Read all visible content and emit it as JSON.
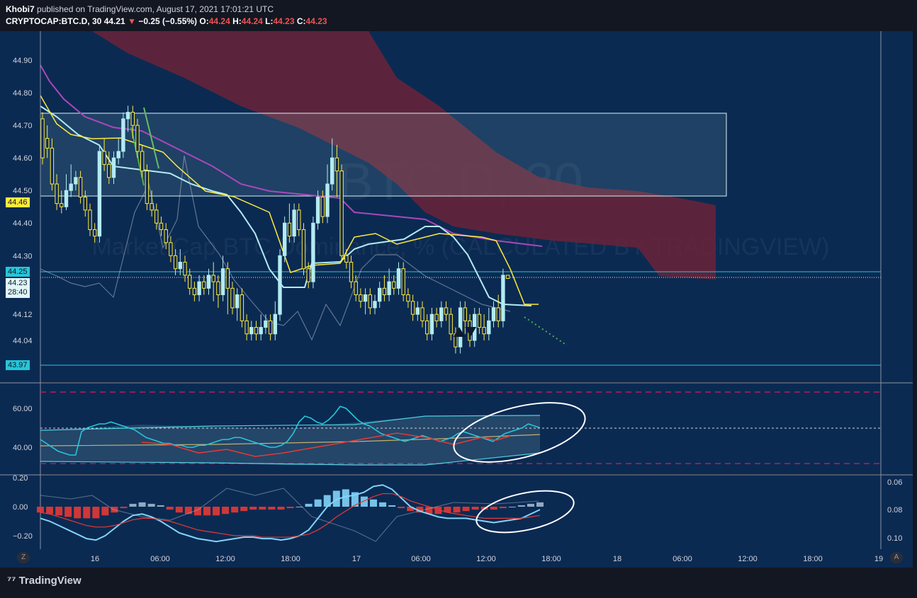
{
  "header": {
    "author": "Khobi7",
    "published_text": "published on TradingView.com, August 17, 2021 17:01:21 UTC",
    "symbol": "CRYPTOCAP:BTC.D, 30",
    "last": "44.21",
    "change_arrow": "▼",
    "change": "−0.25 (−0.55%)",
    "o_label": "O:",
    "o_value": "44.24",
    "h_label": "H:",
    "h_value": "44.24",
    "l_label": "L:",
    "l_value": "44.23",
    "c_label": "C:",
    "c_value": "44.23"
  },
  "watermark": {
    "big": "BTC.D, 30",
    "small": "Market Cap BTC Dominance, % (CALCULATED BY TRADINGVIEW)"
  },
  "price_labels": {
    "level_high": "44.46",
    "level_cyan": "44.25",
    "last_price": "44.23",
    "countdown": "28:40",
    "level_low": "43.97"
  },
  "brand": "TradingView",
  "corner_left": "Z",
  "corner_right": "A",
  "colors": {
    "background": "#0b2a52",
    "bull": "#b2ebf2",
    "bear": "#ffeb3b",
    "cloud": "#6b2338",
    "rsi_line": "#26c6da",
    "rsi_red": "#e53935",
    "macd_line": "#81d4fa"
  },
  "chart_data": [
    {
      "type": "candlestick",
      "title": "CRYPTOCAP:BTC.D, 30",
      "ylim": [
        43.9,
        44.97
      ],
      "yticks": [
        "44.90",
        "44.80",
        "44.70",
        "44.60",
        "44.50",
        "44.40",
        "44.30",
        "44.12",
        "44.04"
      ],
      "xticks": [
        "16",
        "06:00",
        "12:00",
        "18:00",
        "17",
        "06:00",
        "12:00",
        "18:00",
        "18",
        "06:00",
        "12:00",
        "18:00",
        "19"
      ],
      "candles": [
        [
          44.72,
          44.6,
          44.74,
          44.58
        ],
        [
          44.66,
          44.63,
          44.7,
          44.6
        ],
        [
          44.63,
          44.52,
          44.66,
          44.5
        ],
        [
          44.52,
          44.46,
          44.55,
          44.44
        ],
        [
          44.46,
          44.45,
          44.5,
          44.43
        ],
        [
          44.45,
          44.5,
          44.55,
          44.44
        ],
        [
          44.5,
          44.52,
          44.58,
          44.48
        ],
        [
          44.52,
          44.54,
          44.56,
          44.5
        ],
        [
          44.54,
          44.48,
          44.56,
          44.46
        ],
        [
          44.48,
          44.44,
          44.5,
          44.42
        ],
        [
          44.44,
          44.38,
          44.46,
          44.36
        ],
        [
          44.38,
          44.36,
          44.4,
          44.34
        ],
        [
          44.36,
          44.62,
          44.64,
          44.34
        ],
        [
          44.62,
          44.58,
          44.66,
          44.56
        ],
        [
          44.58,
          44.54,
          44.62,
          44.52
        ],
        [
          44.54,
          44.6,
          44.62,
          44.52
        ],
        [
          44.6,
          44.62,
          44.66,
          44.58
        ],
        [
          44.62,
          44.72,
          44.74,
          44.6
        ],
        [
          44.72,
          44.74,
          44.76,
          44.68
        ],
        [
          44.74,
          44.7,
          44.76,
          44.66
        ],
        [
          44.7,
          44.62,
          44.72,
          44.6
        ],
        [
          44.62,
          44.56,
          44.64,
          44.54
        ],
        [
          44.56,
          44.46,
          44.58,
          44.44
        ],
        [
          44.46,
          44.44,
          44.5,
          44.42
        ],
        [
          44.44,
          44.4,
          44.46,
          44.38
        ],
        [
          44.4,
          44.38,
          44.42,
          44.36
        ],
        [
          44.38,
          44.34,
          44.4,
          44.32
        ],
        [
          44.34,
          44.3,
          44.36,
          44.28
        ],
        [
          44.3,
          44.26,
          44.32,
          44.24
        ],
        [
          44.26,
          44.28,
          44.32,
          44.24
        ],
        [
          44.28,
          44.24,
          44.3,
          44.22
        ],
        [
          44.24,
          44.2,
          44.26,
          44.18
        ],
        [
          44.2,
          44.18,
          44.22,
          44.16
        ],
        [
          44.18,
          44.22,
          44.24,
          44.16
        ],
        [
          44.22,
          44.2,
          44.24,
          44.18
        ],
        [
          44.2,
          44.24,
          44.26,
          44.18
        ],
        [
          44.24,
          44.22,
          44.28,
          44.16
        ],
        [
          44.22,
          44.18,
          44.24,
          44.14
        ],
        [
          44.18,
          44.26,
          44.3,
          44.16
        ],
        [
          44.26,
          44.2,
          44.28,
          44.12
        ],
        [
          44.2,
          44.14,
          44.22,
          44.12
        ],
        [
          44.14,
          44.18,
          44.2,
          44.1
        ],
        [
          44.18,
          44.1,
          44.2,
          44.08
        ],
        [
          44.1,
          44.06,
          44.12,
          44.04
        ],
        [
          44.06,
          44.08,
          44.1,
          44.04
        ],
        [
          44.08,
          44.06,
          44.1,
          44.04
        ],
        [
          44.06,
          44.08,
          44.12,
          44.04
        ],
        [
          44.08,
          44.1,
          44.12,
          44.06
        ],
        [
          44.1,
          44.06,
          44.12,
          44.04
        ],
        [
          44.06,
          44.12,
          44.16,
          44.04
        ],
        [
          44.12,
          44.3,
          44.32,
          44.1
        ],
        [
          44.3,
          44.4,
          44.42,
          44.28
        ],
        [
          44.4,
          44.36,
          44.46,
          44.34
        ],
        [
          44.36,
          44.44,
          44.46,
          44.34
        ],
        [
          44.44,
          44.38,
          44.46,
          44.36
        ],
        [
          44.38,
          44.26,
          44.4,
          44.24
        ],
        [
          44.26,
          44.22,
          44.28,
          44.2
        ],
        [
          44.22,
          44.4,
          44.42,
          44.2
        ],
        [
          44.4,
          44.48,
          44.5,
          44.38
        ],
        [
          44.48,
          44.42,
          44.5,
          44.4
        ],
        [
          44.42,
          44.52,
          44.58,
          44.4
        ],
        [
          44.52,
          44.6,
          44.66,
          44.5
        ],
        [
          44.6,
          44.56,
          44.64,
          44.48
        ],
        [
          44.56,
          44.3,
          44.58,
          44.28
        ],
        [
          44.3,
          44.28,
          44.32,
          44.26
        ],
        [
          44.28,
          44.22,
          44.3,
          44.2
        ],
        [
          44.22,
          44.18,
          44.24,
          44.16
        ],
        [
          44.18,
          44.16,
          44.2,
          44.14
        ],
        [
          44.16,
          44.18,
          44.2,
          44.12
        ],
        [
          44.18,
          44.14,
          44.2,
          44.12
        ],
        [
          44.14,
          44.16,
          44.18,
          44.12
        ],
        [
          44.16,
          44.2,
          44.22,
          44.14
        ],
        [
          44.2,
          44.18,
          44.24,
          44.16
        ],
        [
          44.18,
          44.22,
          44.26,
          44.16
        ],
        [
          44.22,
          44.2,
          44.24,
          44.18
        ],
        [
          44.2,
          44.26,
          44.28,
          44.18
        ],
        [
          44.26,
          44.18,
          44.28,
          44.16
        ],
        [
          44.18,
          44.16,
          44.2,
          44.14
        ],
        [
          44.16,
          44.12,
          44.18,
          44.1
        ],
        [
          44.12,
          44.14,
          44.16,
          44.1
        ],
        [
          44.14,
          44.1,
          44.16,
          44.08
        ],
        [
          44.1,
          44.06,
          44.12,
          44.04
        ],
        [
          44.06,
          44.12,
          44.14,
          44.04
        ],
        [
          44.12,
          44.1,
          44.14,
          44.08
        ],
        [
          44.1,
          44.14,
          44.16,
          44.08
        ],
        [
          44.14,
          44.12,
          44.16,
          44.1
        ],
        [
          44.12,
          44.06,
          44.14,
          44.04
        ],
        [
          44.06,
          44.02,
          44.08,
          44.0
        ],
        [
          44.02,
          44.14,
          44.16,
          44.0
        ],
        [
          44.14,
          44.1,
          44.16,
          44.06
        ],
        [
          44.1,
          44.04,
          44.12,
          44.02
        ],
        [
          44.04,
          44.12,
          44.14,
          44.02
        ],
        [
          44.12,
          44.08,
          44.14,
          44.06
        ],
        [
          44.08,
          44.06,
          44.12,
          44.04
        ],
        [
          44.06,
          44.1,
          44.14,
          44.04
        ],
        [
          44.1,
          44.14,
          44.16,
          44.08
        ],
        [
          44.14,
          44.1,
          44.18,
          44.08
        ],
        [
          44.1,
          44.24,
          44.26,
          44.08
        ],
        [
          44.24,
          44.23,
          44.24,
          44.23
        ]
      ]
    },
    {
      "type": "line",
      "title": "RSI",
      "ylim": [
        30,
        70
      ],
      "yticks": [
        "60.00",
        "40.00"
      ],
      "series": [
        {
          "values": [
            44,
            42,
            40,
            38,
            37,
            36,
            36,
            48,
            50,
            51,
            52,
            52,
            53,
            52,
            51,
            50,
            49,
            47,
            45,
            44,
            43,
            42,
            42,
            41,
            41,
            40,
            40,
            41,
            41,
            42,
            43,
            44,
            44,
            45,
            45,
            44,
            43,
            42,
            41,
            40,
            40,
            41,
            43,
            47,
            53,
            56,
            55,
            53,
            52,
            54,
            57,
            61,
            60,
            57,
            54,
            52,
            51,
            49,
            47,
            46,
            45,
            44,
            43,
            44,
            45,
            46,
            45,
            44,
            43,
            44,
            45,
            47,
            48,
            47,
            46,
            45,
            44,
            43,
            45,
            47,
            48,
            49,
            50,
            52,
            51,
            50
          ]
        }
      ]
    },
    {
      "type": "line",
      "title": "MACD",
      "ylim": [
        -0.25,
        0.22
      ],
      "yticks": [
        "0.20",
        "0.00",
        "-0.20"
      ],
      "yticks_right": [
        "0.06",
        "0.08",
        "0.10"
      ],
      "series": [
        {
          "values": [
            -0.08,
            -0.1,
            -0.13,
            -0.16,
            -0.19,
            -0.22,
            -0.23,
            -0.2,
            -0.15,
            -0.1,
            -0.06,
            -0.05,
            -0.07,
            -0.1,
            -0.14,
            -0.18,
            -0.2,
            -0.22,
            -0.23,
            -0.24,
            -0.23,
            -0.22,
            -0.21,
            -0.21,
            -0.22,
            -0.22,
            -0.23,
            -0.22,
            -0.2,
            -0.16,
            -0.08,
            0.0,
            0.05,
            0.07,
            0.08,
            0.1,
            0.14,
            0.15,
            0.12,
            0.06,
            0.0,
            -0.03,
            -0.05,
            -0.07,
            -0.08,
            -0.08,
            -0.08,
            -0.09,
            -0.1,
            -0.11,
            -0.1,
            -0.09,
            -0.08,
            -0.05,
            -0.02
          ]
        },
        {
          "values": [
            -0.04,
            -0.05,
            -0.07,
            -0.09,
            -0.11,
            -0.13,
            -0.14,
            -0.14,
            -0.13,
            -0.11,
            -0.09,
            -0.08,
            -0.08,
            -0.09,
            -0.1,
            -0.12,
            -0.14,
            -0.16,
            -0.17,
            -0.18,
            -0.19,
            -0.2,
            -0.2,
            -0.2,
            -0.21,
            -0.21,
            -0.21,
            -0.21,
            -0.2,
            -0.19,
            -0.16,
            -0.12,
            -0.07,
            -0.03,
            0.01,
            0.04,
            0.07,
            0.09,
            0.09,
            0.07,
            0.04,
            0.02,
            0.0,
            -0.02,
            -0.04,
            -0.05,
            -0.06,
            -0.07,
            -0.08,
            -0.08,
            -0.08,
            -0.08,
            -0.08,
            -0.07,
            -0.06
          ]
        }
      ]
    }
  ]
}
